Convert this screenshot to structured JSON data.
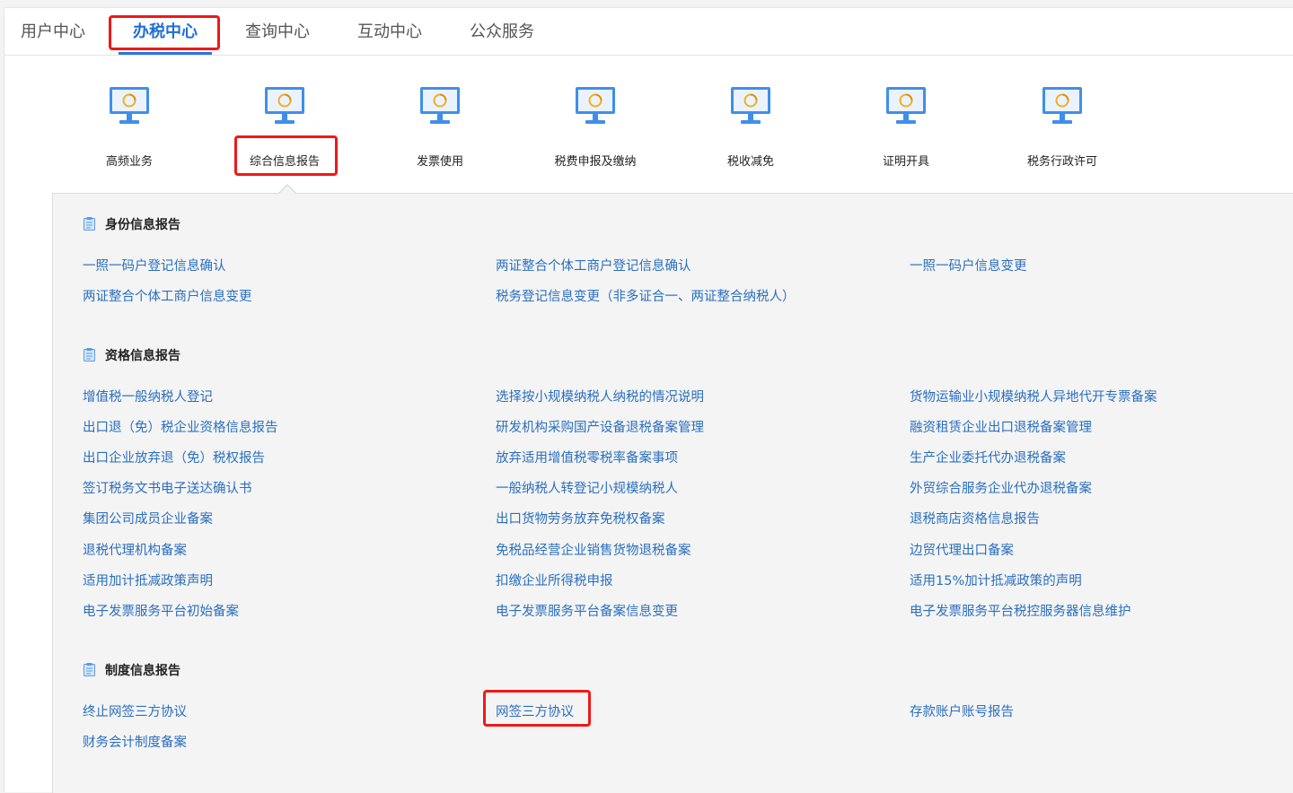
{
  "tabs": [
    "用户中心",
    "办税中心",
    "查询中心",
    "互动中心",
    "公众服务"
  ],
  "active_tab": "办税中心",
  "categories": [
    "高频业务",
    "综合信息报告",
    "发票使用",
    "税费申报及缴纳",
    "税收减免",
    "证明开具",
    "税务行政许可"
  ],
  "colors": {
    "accent": "#2b74d9",
    "link": "#2a6fbf",
    "highlight": "#f01818"
  },
  "sections": [
    {
      "title": "身份信息报告",
      "items": [
        "一照一码户登记信息确认",
        "两证整合个体工商户登记信息确认",
        "一照一码户信息变更",
        "两证整合个体工商户信息变更",
        "税务登记信息变更（非多证合一、两证整合纳税人）"
      ]
    },
    {
      "title": "资格信息报告",
      "items": [
        "增值税一般纳税人登记",
        "选择按小规模纳税人纳税的情况说明",
        "货物运输业小规模纳税人异地代开专票备案",
        "出口退（免）税企业资格信息报告",
        "研发机构采购国产设备退税备案管理",
        "融资租赁企业出口退税备案管理",
        "出口企业放弃退（免）税权报告",
        "放弃适用增值税零税率备案事项",
        "生产企业委托代办退税备案",
        "签订税务文书电子送达确认书",
        "一般纳税人转登记小规模纳税人",
        "外贸综合服务企业代办退税备案",
        "集团公司成员企业备案",
        "出口货物劳务放弃免税权备案",
        "退税商店资格信息报告",
        "退税代理机构备案",
        "免税品经营企业销售货物退税备案",
        "边贸代理出口备案",
        "适用加计抵减政策声明",
        "扣缴企业所得税申报",
        "适用15%加计抵减政策的声明",
        "电子发票服务平台初始备案",
        "电子发票服务平台备案信息变更",
        "电子发票服务平台税控服务器信息维护"
      ]
    },
    {
      "title": "制度信息报告",
      "items": [
        "终止网签三方协议",
        "网签三方协议",
        "存款账户账号报告",
        "财务会计制度备案"
      ]
    }
  ]
}
